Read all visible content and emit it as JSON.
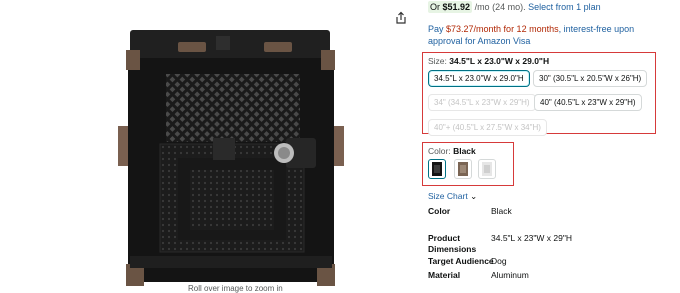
{
  "image": {
    "caption": "Roll over image to zoom in"
  },
  "price": {
    "or": "Or",
    "amount": "$51.92",
    "term": "/mo (24 mo).",
    "select_plan": "Select from 1 plan"
  },
  "financing": {
    "prefix": "Pay ",
    "monthly": "$73.27/month for 12 months",
    "suffix": ", interest-free upon approval for Amazon Visa"
  },
  "size": {
    "label": "Size:",
    "selected": "34.5\"L x 23.0\"W x 29.0\"H",
    "options": [
      "34.5\"L x 23.0\"W x 29.0\"H",
      "30\" (30.5\"L x 20.5\"W x 26\"H)",
      "34\" (34.5\"L x 23\"W x 29\"H)",
      "40\" (40.5\"L x 23\"W x 29\"H)",
      "40\"+ (40.5\"L x 27.5\"W x 34\"H)"
    ]
  },
  "color": {
    "label": "Color:",
    "selected": "Black",
    "swatches": [
      "Black",
      "Bronze",
      "White"
    ]
  },
  "size_chart": "Size Chart",
  "details": [
    {
      "key": "Color",
      "value": "Black"
    },
    {
      "key": "Product Dimensions",
      "value": "34.5\"L x 23\"W x 29\"H"
    },
    {
      "key": "Target Audience",
      "value": "Dog"
    },
    {
      "key": "Material",
      "value": "Aluminum"
    }
  ]
}
